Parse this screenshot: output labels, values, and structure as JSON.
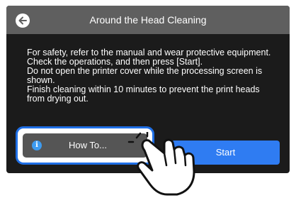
{
  "header": {
    "title": "Around the Head Cleaning"
  },
  "message": {
    "lines": [
      "For safety, refer to the manual and wear protective equipment.",
      "Check the operations, and then press [Start].",
      "Do not open the printer cover while the processing screen is shown.",
      "Finish cleaning within 10 minutes to prevent the print heads from drying out."
    ]
  },
  "buttons": {
    "howto_label": "How To...",
    "start_label": "Start"
  },
  "icons": {
    "back": "arrow-left-icon",
    "info": "info-icon",
    "pointer": "pointing-hand-icon"
  },
  "colors": {
    "header_bg": "#5f5f5f",
    "screen_bg": "#1b1b1b",
    "start_bg": "#2f7cf2",
    "highlight": "#1f6fe6"
  }
}
